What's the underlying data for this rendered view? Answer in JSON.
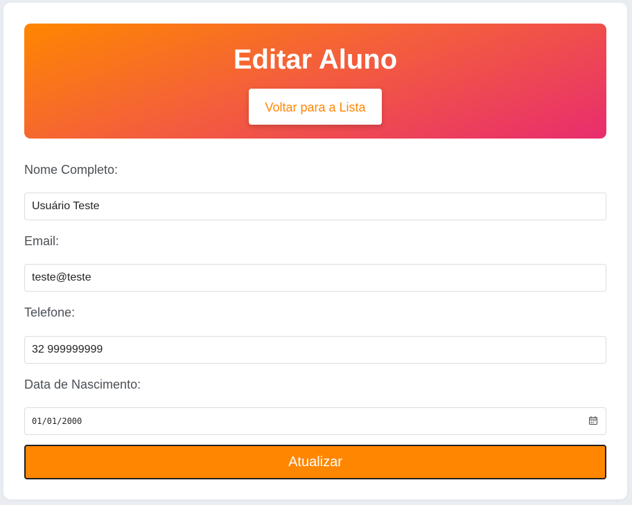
{
  "header": {
    "title": "Editar Aluno",
    "back_button_label": "Voltar para a Lista"
  },
  "form": {
    "fields": [
      {
        "label": "Nome Completo:",
        "value": "Usuário Teste"
      },
      {
        "label": "Email:",
        "value": "teste@teste"
      },
      {
        "label": "Telefone:",
        "value": "32 999999999"
      },
      {
        "label": "Data de Nascimento:",
        "value": "01/01/2000"
      }
    ],
    "submit_label": "Atualizar"
  },
  "colors": {
    "accent": "#ff8600",
    "gradient_start": "#ff8600",
    "gradient_end": "#e82d6e"
  },
  "icons": {
    "date_picker": "calendar-icon"
  }
}
